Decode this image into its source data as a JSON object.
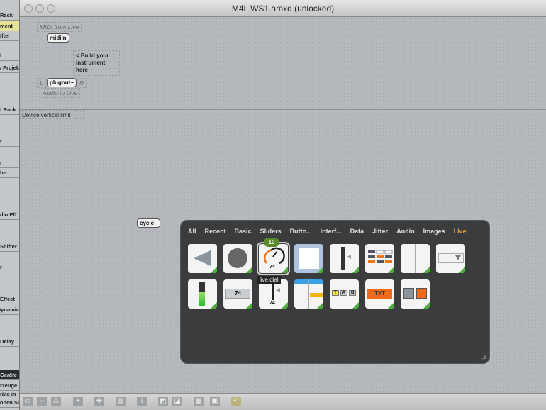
{
  "window": {
    "title": "M4L WS1.amxd (unlocked)"
  },
  "sidebar": {
    "items": [
      "Rack",
      "ment",
      "ifter",
      "l",
      "s Projek",
      "t Rack",
      "t",
      "r",
      "be",
      "dio Eff",
      "Shifter",
      "r",
      "Effect",
      "Dynamic",
      "Delay",
      "Geräte",
      "rzeuge",
      "räte in",
      "ohen Si"
    ]
  },
  "patch": {
    "midi_comment": "MIDI from Live",
    "midiin": "midiin",
    "build_note": "< Build your instrument here",
    "plug_L": "L",
    "plugout": "plugout~",
    "plug_R": "R",
    "audio_comment": "Audio to Live",
    "limit_label": "Device vertical limit",
    "cycle": "cycle~"
  },
  "palette": {
    "tabs": [
      "All",
      "Recent",
      "Basic",
      "Sliders",
      "Butto...",
      "Interf...",
      "Data",
      "Jitter",
      "Audio",
      "Images",
      "Live"
    ],
    "active_tab": "Live",
    "badge": "10",
    "tooltip": "live.dial",
    "dial_value": "74",
    "number_value": "74",
    "slider_value": "74",
    "tab_letters": [
      "T",
      "A",
      "B"
    ],
    "text_label": "TXT"
  },
  "toolbar": {
    "icons": [
      "lock-icon",
      "presentation-icon",
      "warning-icon",
      "add-icon",
      "move-icon",
      "inspector-icon",
      "info-icon",
      "front-icon",
      "back-icon",
      "grid-icon",
      "snap-icon",
      "undo-icon"
    ]
  },
  "colors": {
    "accent": "#e8a23b",
    "green": "#4caf3a",
    "orange": "#f06a1c"
  }
}
